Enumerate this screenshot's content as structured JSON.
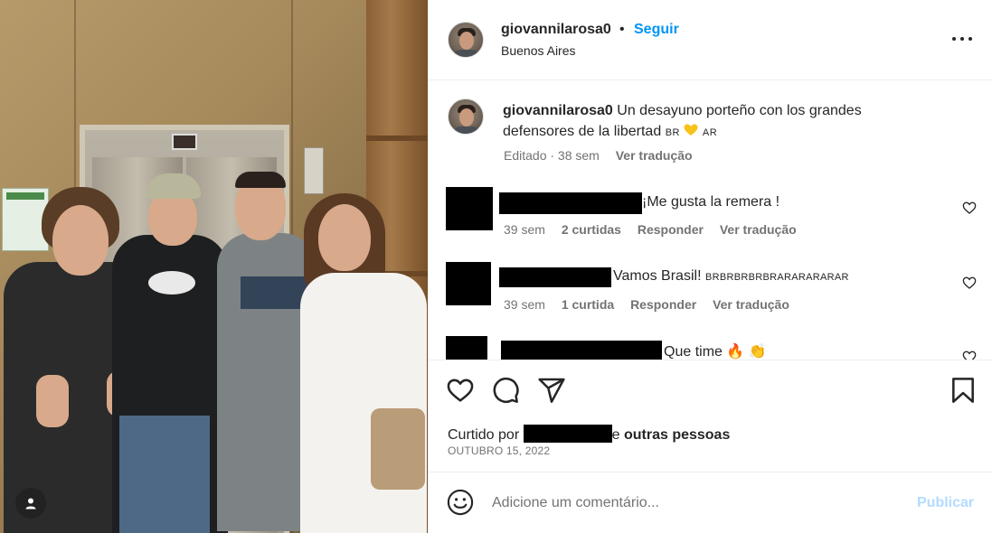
{
  "post": {
    "username": "giovannilarosa0",
    "follow_label": "Seguir",
    "separator": "•",
    "location": "Buenos Aires",
    "more_icon": "more-horizontal-icon"
  },
  "caption": {
    "username": "giovannilarosa0",
    "text": "Un desayuno porteño con los grandes defensores de la libertad",
    "flag_left": "BR",
    "flag_right": "AR",
    "edited": "Editado · 38 sem",
    "translate": "Ver tradução"
  },
  "comments": [
    {
      "text": "¡Me gusta la remera !",
      "age": "39 sem",
      "likes": "2 curtidas",
      "reply": "Responder",
      "translate": "Ver tradução"
    },
    {
      "text": "Vamos Brasil!",
      "suffix": "BRBRBRBRBRARARARARAR",
      "age": "39 sem",
      "likes": "1 curtida",
      "reply": "Responder",
      "translate": "Ver tradução"
    },
    {
      "text": "Que time",
      "emoji": "🔥 👏"
    }
  ],
  "actions": {
    "liked_prefix": "Curtido por",
    "liked_suffix": "e",
    "liked_others": "outras pessoas",
    "date": "OUTUBRO 15, 2022"
  },
  "compose": {
    "placeholder": "Adicione um comentário...",
    "publish_label": "Publicar"
  },
  "colors": {
    "accent": "#0095f6",
    "publish_disabled": "#b3dbff",
    "muted_text": "#737373"
  }
}
